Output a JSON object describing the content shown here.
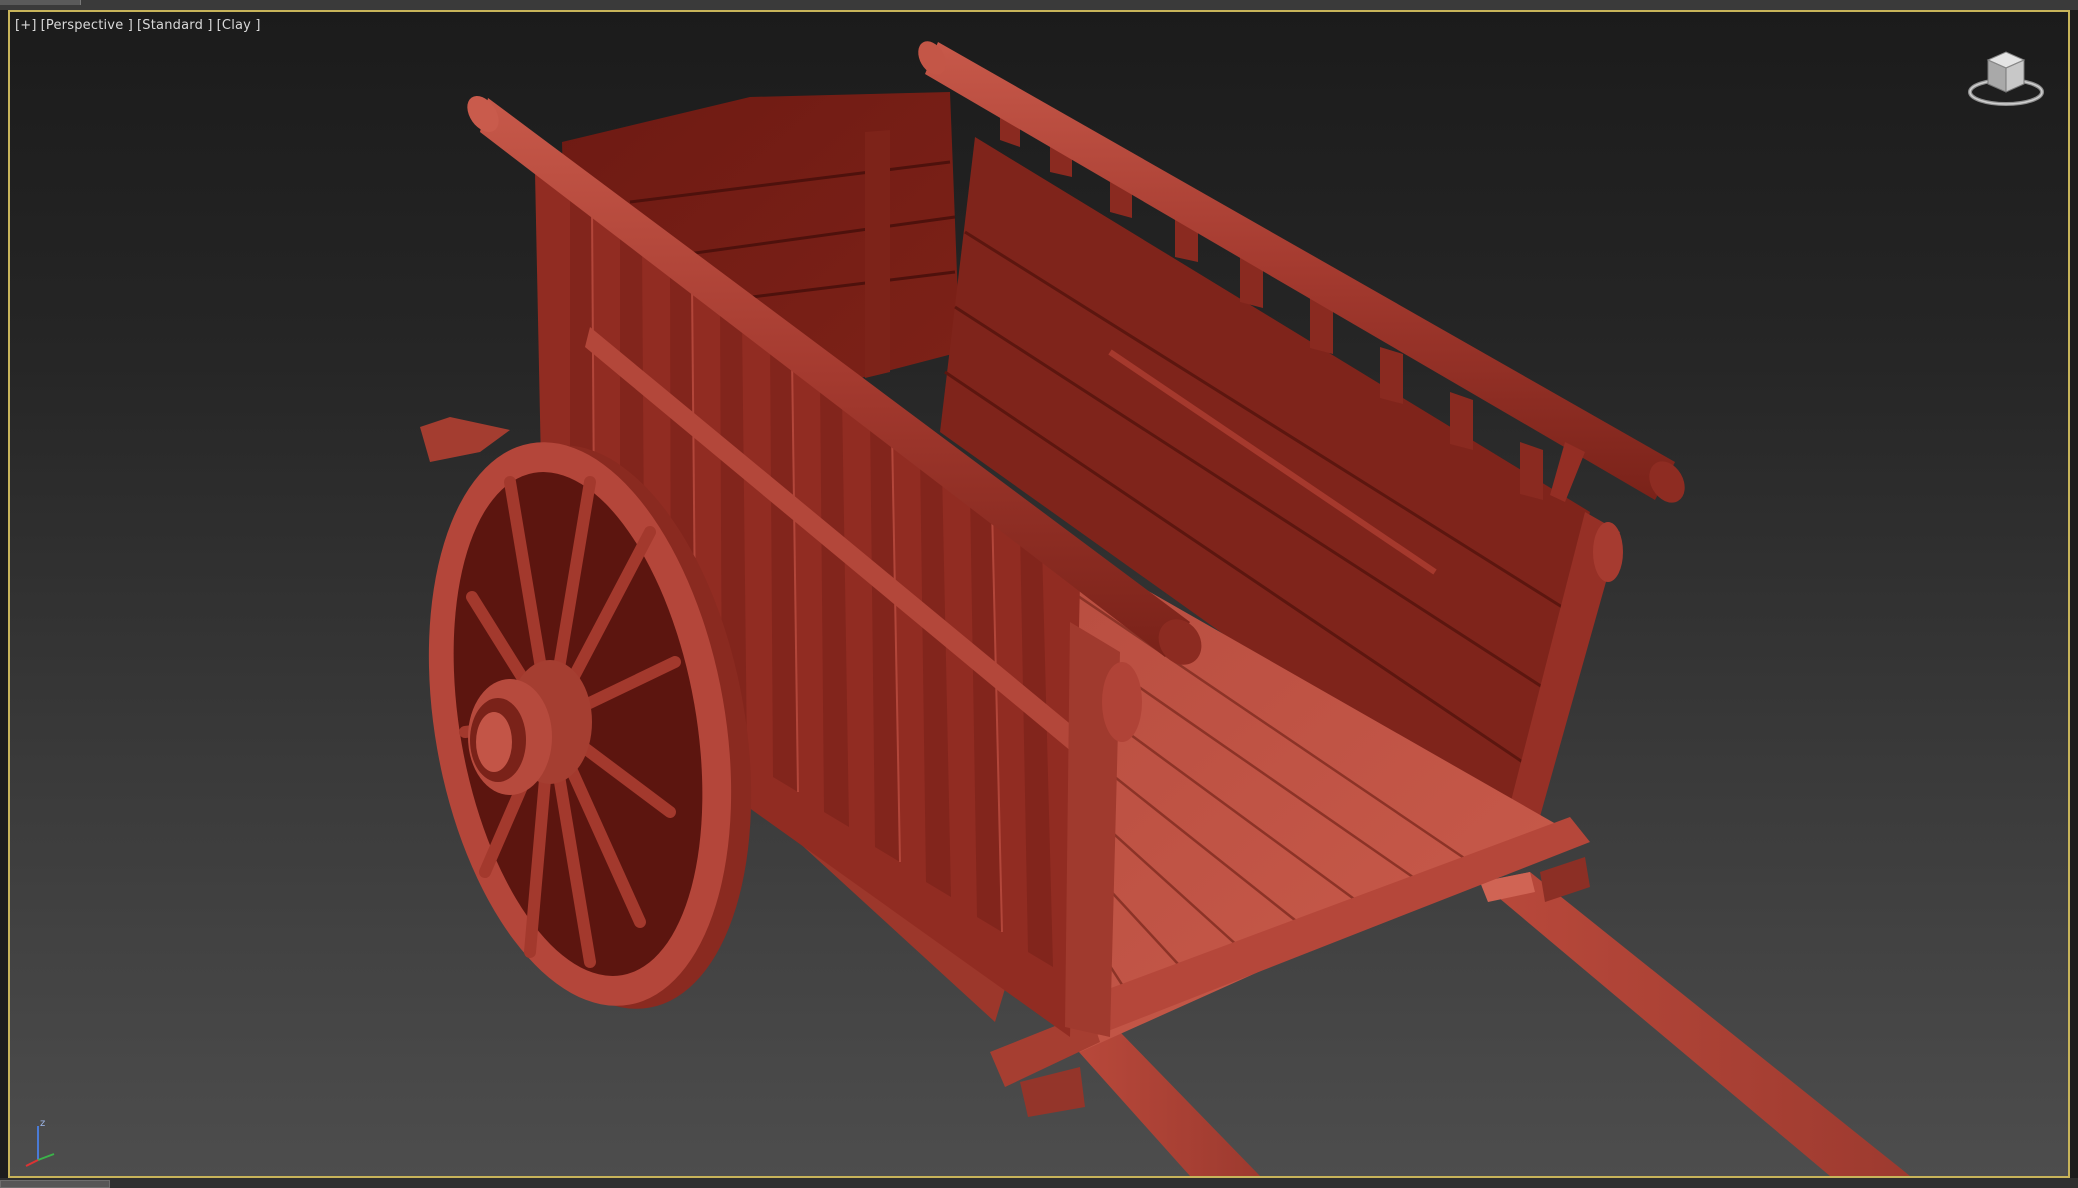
{
  "viewport": {
    "labels": [
      {
        "text": "[+]"
      },
      {
        "text": "[Perspective ]"
      },
      {
        "text": "[Standard ]"
      },
      {
        "text": "[Clay ]"
      }
    ],
    "accent_border_color": "#c8b45a",
    "model_color": "#8b2b22"
  },
  "axis_tripod": {
    "z_label": "z"
  },
  "icons": {
    "viewcube": "viewcube-icon",
    "axis": "axis-tripod-icon"
  }
}
